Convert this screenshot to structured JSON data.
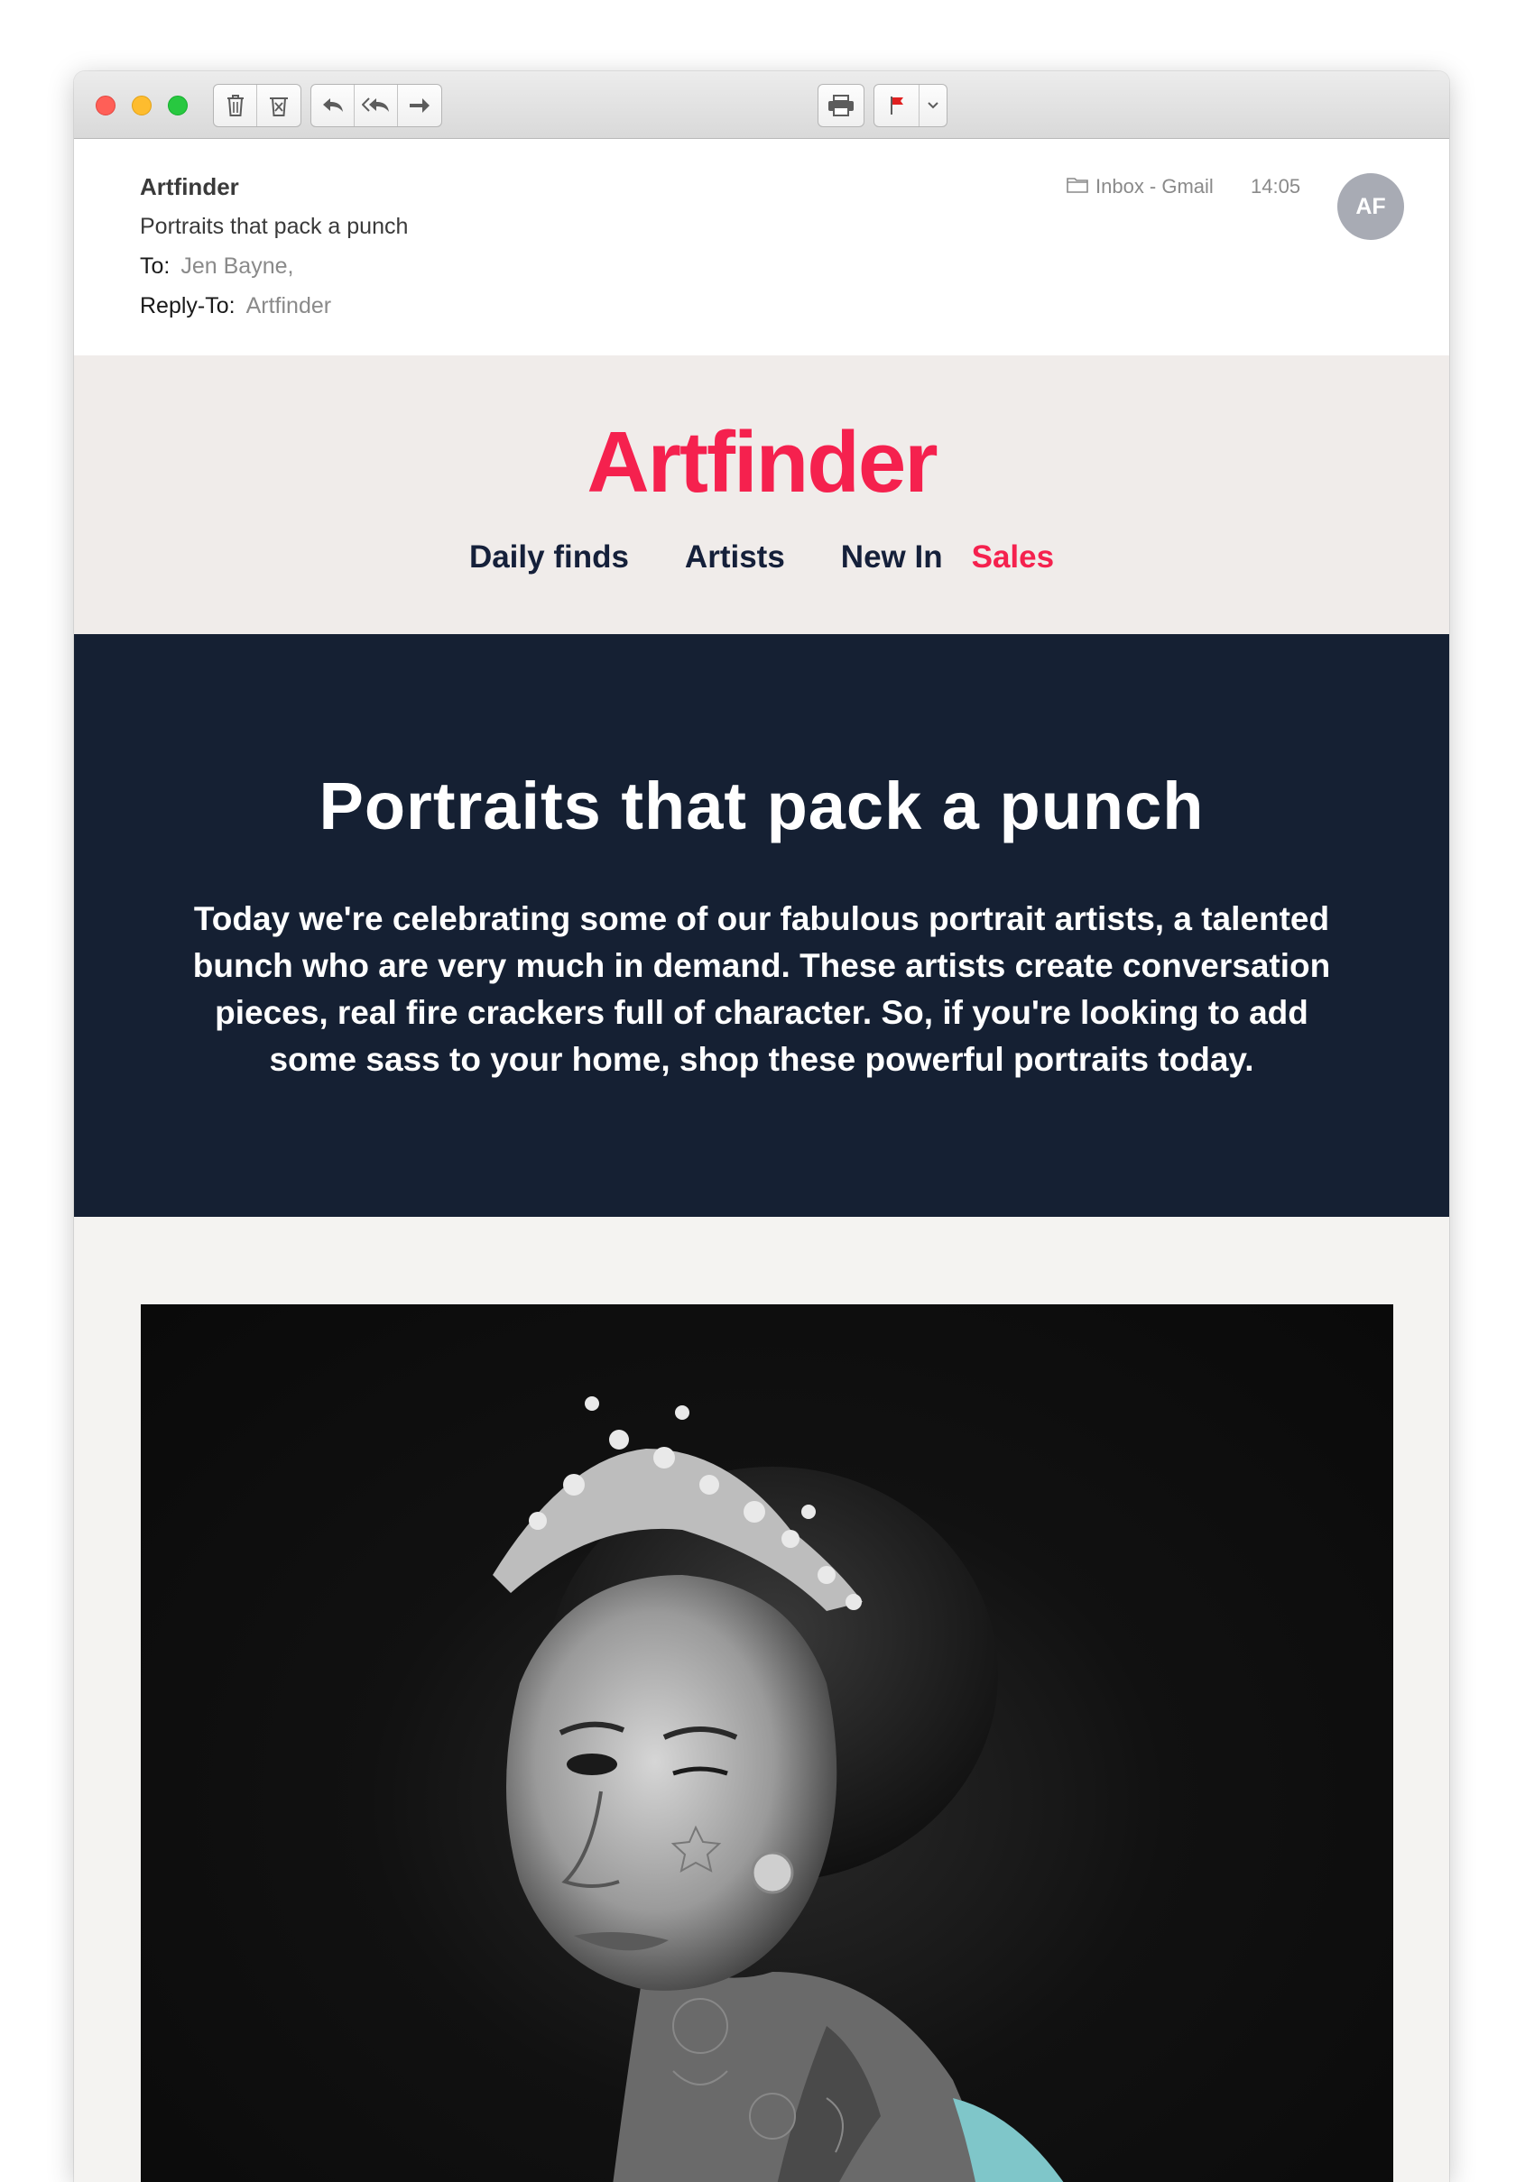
{
  "toolbar": {
    "buttons": [
      "trash-icon",
      "junk-icon",
      "reply-icon",
      "reply-all-icon",
      "forward-icon",
      "print-icon",
      "flag-icon",
      "chevron-down-icon"
    ],
    "flag_color": "#e02020"
  },
  "header": {
    "sender": "Artfinder",
    "subject": "Portraits that pack a punch",
    "to_label": "To:",
    "to_value": "Jen Bayne,",
    "reply_to_label": "Reply-To:",
    "reply_to_value": "Artfinder",
    "mailbox": "Inbox - Gmail",
    "time": "14:05",
    "avatar_initials": "AF"
  },
  "email": {
    "logo": "Artfinder",
    "nav": [
      "Daily finds",
      "Artists",
      "New In",
      "Sales"
    ],
    "hero_title": "Portraits that pack a punch",
    "hero_body": "Today we're celebrating some of our fabulous portrait artists, a talented bunch who are very much in demand. These artists create conversation pieces, real fire crackers full of character. So, if you're looking to add some sass to your home, shop these powerful portraits today.",
    "brand_color": "#f5214e",
    "navy_color": "#152033",
    "image_subject": "tattooed-queen-portrait"
  }
}
